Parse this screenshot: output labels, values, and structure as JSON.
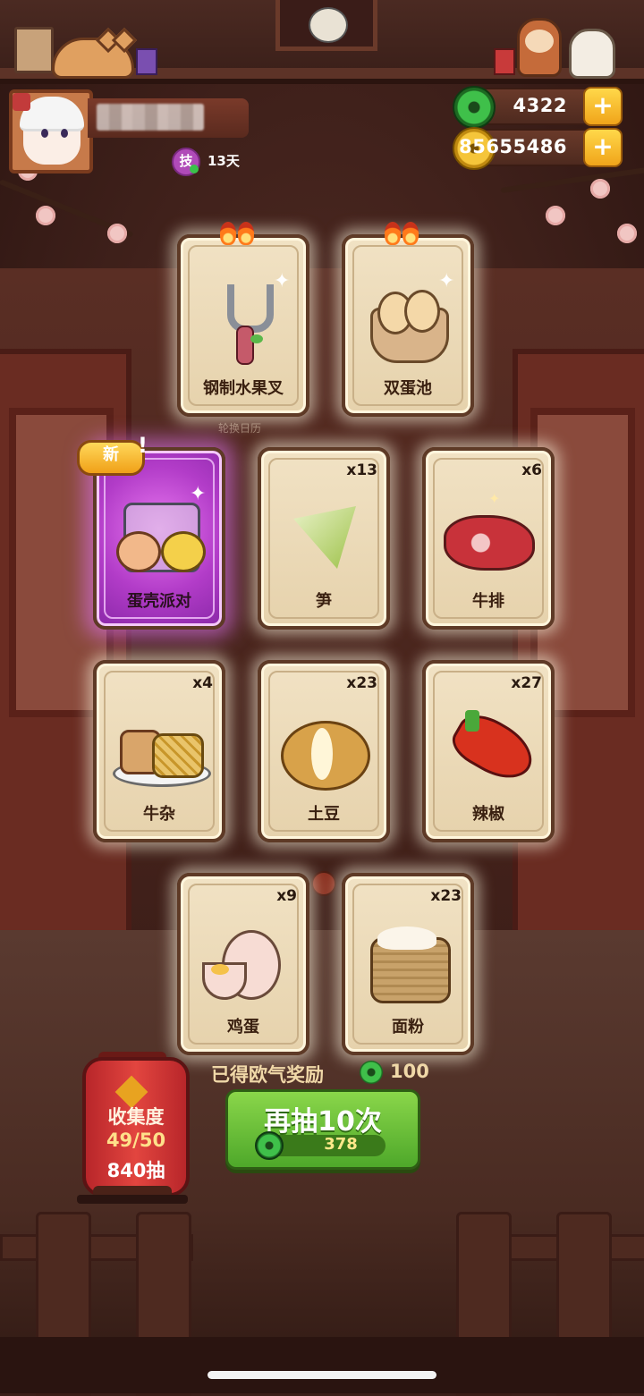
{
  "header": {
    "player_days": "13天",
    "skill_badge": "技"
  },
  "currencies": {
    "jade": {
      "value": "4322",
      "icon": "jade-coin-icon"
    },
    "gold": {
      "value": "85655486",
      "icon": "gold-coin-icon"
    },
    "plus_label": "+"
  },
  "calendar_label": "轮换日历",
  "cards": [
    {
      "name": "钢制水果叉",
      "count": "",
      "hot": true,
      "new": false
    },
    {
      "name": "双蛋池",
      "count": "",
      "hot": true,
      "new": false
    },
    {
      "name": "蛋壳派对",
      "count": "",
      "hot": false,
      "new": true
    },
    {
      "name": "笋",
      "count": "x13",
      "hot": false,
      "new": false
    },
    {
      "name": "牛排",
      "count": "x6",
      "hot": false,
      "new": false
    },
    {
      "name": "牛杂",
      "count": "x4",
      "hot": false,
      "new": false
    },
    {
      "name": "土豆",
      "count": "x23",
      "hot": false,
      "new": false
    },
    {
      "name": "辣椒",
      "count": "x27",
      "hot": false,
      "new": false
    },
    {
      "name": "鸡蛋",
      "count": "x9",
      "hot": false,
      "new": false
    },
    {
      "name": "面粉",
      "count": "x23",
      "hot": false,
      "new": false
    }
  ],
  "new_badge": "新",
  "collection": {
    "title": "收集度",
    "progress": "49/50",
    "draws": "840抽"
  },
  "reward": {
    "label": "已得欧气奖励",
    "value": "100"
  },
  "draw_button": {
    "label": "再抽10次",
    "cost": "378"
  },
  "colors": {
    "card_bg": "#f1e2c4",
    "new_card_glow": "#b23cc8",
    "draw_button": "#6cc23a",
    "lantern": "#d63a36"
  }
}
